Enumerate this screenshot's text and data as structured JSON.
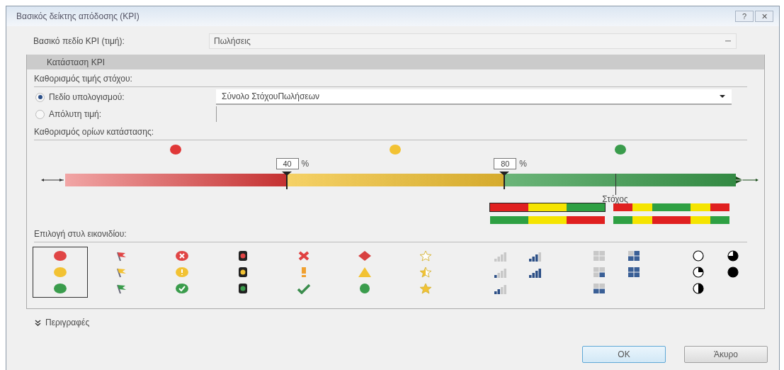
{
  "window": {
    "title": "Βασικός δείκτης απόδοσης (KPI)",
    "buttons": [
      "?",
      "✕"
    ]
  },
  "base_field": {
    "label": "Βασικό πεδίο KPI (τιμή):",
    "value": "Πωλήσεις"
  },
  "kpi_status": {
    "title": "Κατάσταση KPI",
    "target_heading": "Καθορισμός τιμής στόχου:",
    "target_options": [
      {
        "kind": "dropdown",
        "label": "Πεδίο υπολογισμού:",
        "value": "Σύνολο ΣτόχουΠωλήσεων",
        "selected": true
      },
      {
        "kind": "textbox",
        "label": "Απόλυτη τιμή:",
        "selected": false
      }
    ],
    "thresholds_heading": "Καθορισμός ορίων κατάστασης:",
    "bands": [
      {
        "color": "#e03838"
      },
      {
        "color": "#f2c233"
      },
      {
        "color": "#3a9c4c"
      }
    ],
    "thresholds": [
      {
        "value": "40",
        "unit": "%",
        "level": 0.33
      },
      {
        "value": "80",
        "unit": "%",
        "level": 0.655
      }
    ],
    "target": {
      "label": "Στόχος",
      "level": 0.82
    },
    "band_styles": [
      {
        "segments": [
          {
            "color": "#e02020"
          },
          {
            "color": "#f5e400"
          },
          {
            "color": "#2ea043"
          }
        ],
        "selected": true
      },
      {
        "segments": [
          {
            "color": "#e02020"
          },
          {
            "color": "#f5e400"
          },
          {
            "color": "#2ea043"
          },
          {
            "color": "#2ea043"
          },
          {
            "color": "#f5e400"
          },
          {
            "color": "#e02020"
          }
        ],
        "selected": false
      },
      {
        "segments": [
          {
            "color": "#2ea043"
          },
          {
            "color": "#f5e400"
          },
          {
            "color": "#e02020"
          }
        ],
        "selected": false
      },
      {
        "segments": [
          {
            "color": "#2ea043"
          },
          {
            "color": "#f5e400"
          },
          {
            "color": "#e02020"
          },
          {
            "color": "#e02020"
          },
          {
            "color": "#f5e400"
          },
          {
            "color": "#2ea043"
          }
        ],
        "selected": false
      }
    ],
    "icon_heading": "Επιλογή στυλ εικονιδίου:",
    "icon_styles": [
      {
        "kind": "circles",
        "selected": true
      },
      {
        "kind": "flags",
        "selected": false
      },
      {
        "kind": "symbols",
        "selected": false
      },
      {
        "kind": "lights",
        "selected": false
      },
      {
        "kind": "marks",
        "selected": false
      },
      {
        "kind": "shapes",
        "selected": false
      },
      {
        "kind": "stars",
        "selected": false
      },
      {
        "kind": "bars",
        "selected": false
      },
      {
        "kind": "boxes",
        "selected": false
      },
      {
        "kind": "pies",
        "selected": false
      }
    ]
  },
  "descriptions": {
    "label": "Περιγραφές",
    "expanded": false
  },
  "buttons": [
    {
      "label": "OK",
      "kind": "default"
    },
    {
      "label": "Άκυρο",
      "kind": "normal"
    }
  ]
}
